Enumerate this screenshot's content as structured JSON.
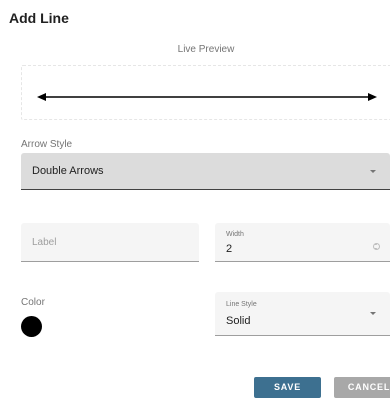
{
  "dialog": {
    "title": "Add Line",
    "preview_label": "Live Preview"
  },
  "arrow_style": {
    "label": "Arrow Style",
    "value": "Double Arrows"
  },
  "label_field": {
    "placeholder": "Label"
  },
  "width_field": {
    "label": "Width",
    "value": "2"
  },
  "color": {
    "label": "Color",
    "value": "#000000"
  },
  "line_style": {
    "label": "Line Style",
    "value": "Solid"
  },
  "buttons": {
    "save": "SAVE",
    "cancel": "CANCEL"
  },
  "icons": {
    "arrow_caret": "chevron-down-icon",
    "stepper": "number-stepper-icon"
  },
  "colors": {
    "save_button": "#3d7090",
    "cancel_button": "#a8a8a8",
    "line_color": "#000000"
  }
}
